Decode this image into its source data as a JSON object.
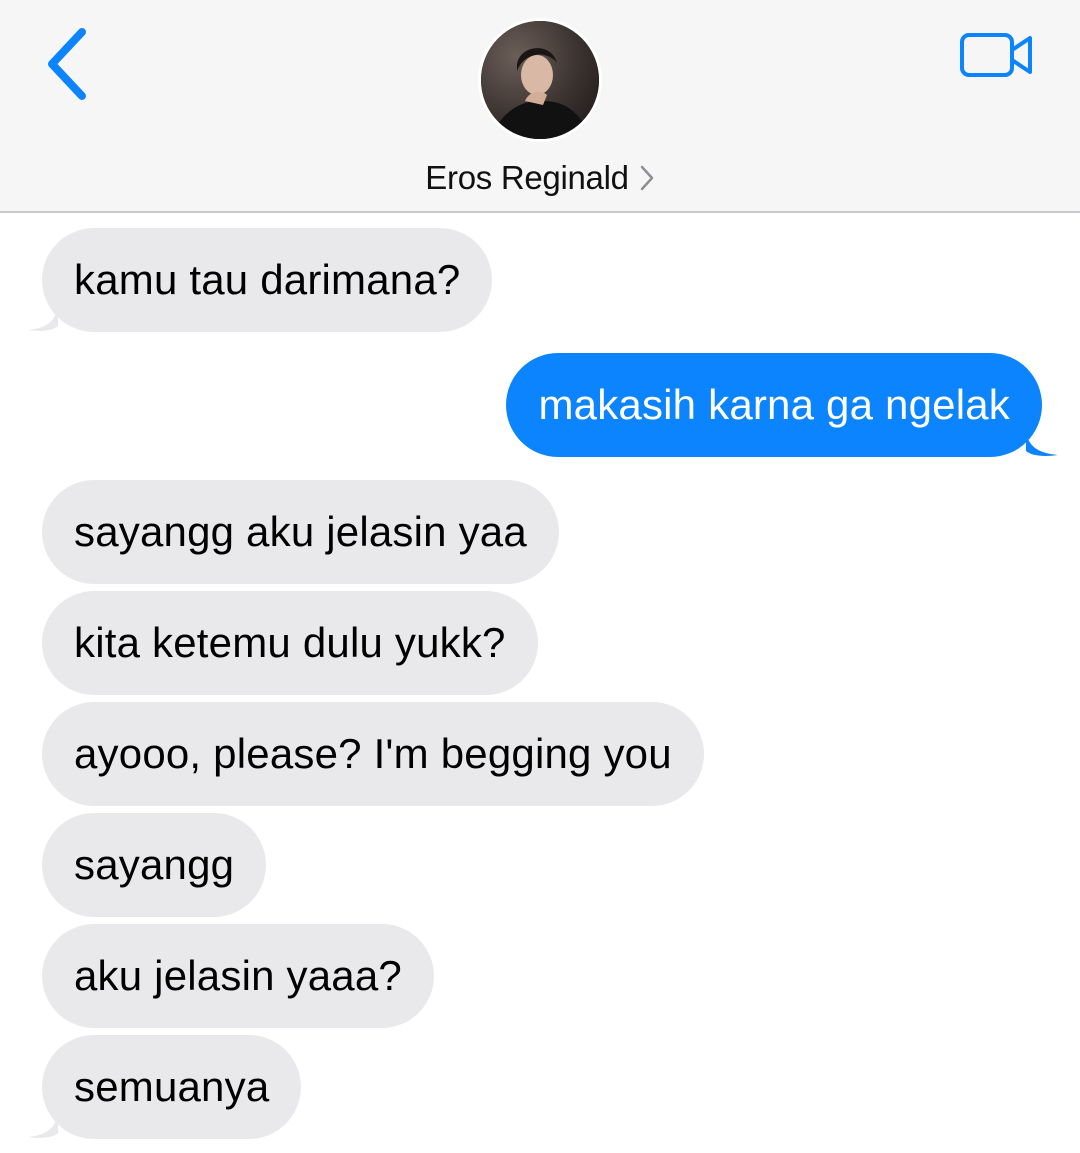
{
  "header": {
    "back_icon": "chevron-left-icon",
    "video_icon": "video-camera-icon",
    "contact_name": "Eros Reginald",
    "contact_chevron_icon": "chevron-right-icon",
    "accent_color": "#0b84fe"
  },
  "messages": [
    {
      "direction": "incoming",
      "text": "kamu tau darimana?",
      "tail": true
    },
    {
      "direction": "outgoing",
      "text": "makasih karna ga ngelak",
      "tail": true
    },
    {
      "direction": "incoming",
      "text": "sayangg aku jelasin yaa",
      "tail": false
    },
    {
      "direction": "incoming",
      "text": "kita ketemu dulu yukk?",
      "tail": false
    },
    {
      "direction": "incoming",
      "text": "ayooo, please? I'm begging you",
      "tail": false
    },
    {
      "direction": "incoming",
      "text": "sayangg",
      "tail": false
    },
    {
      "direction": "incoming",
      "text": "aku jelasin yaaa?",
      "tail": false
    },
    {
      "direction": "incoming",
      "text": "semuanya",
      "tail": true
    }
  ],
  "colors": {
    "incoming_bubble": "#e9e9eb",
    "outgoing_bubble": "#0b84fe",
    "header_bg": "#f6f6f6"
  }
}
